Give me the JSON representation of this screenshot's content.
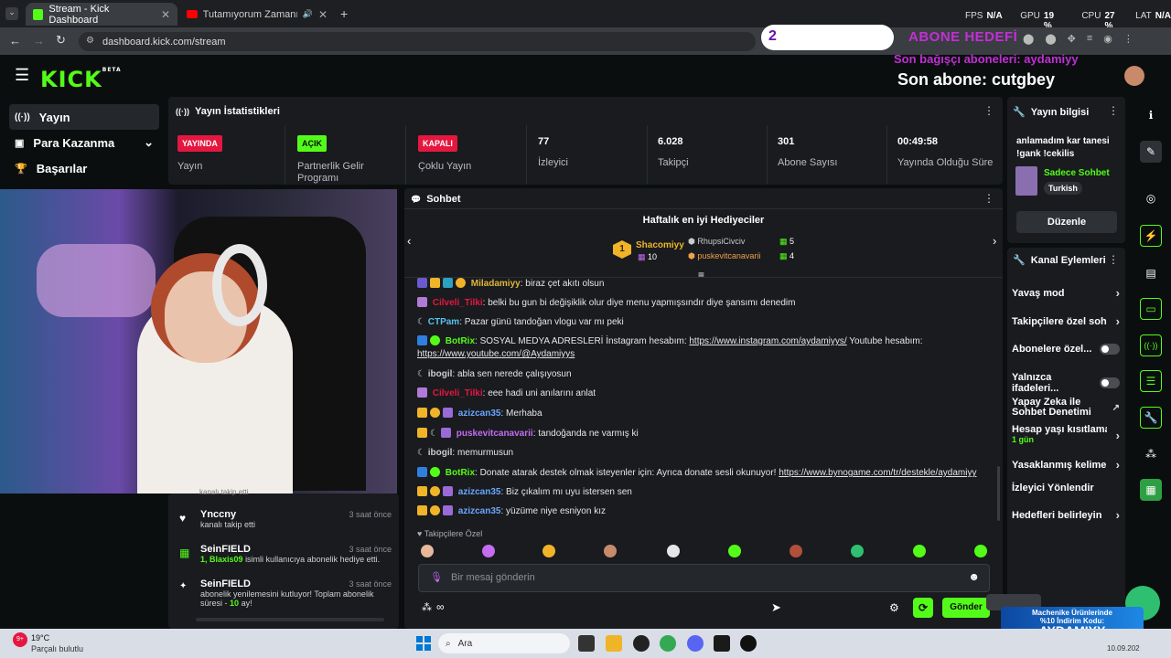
{
  "browser": {
    "tabs": [
      {
        "label": "Stream - Kick Dashboard",
        "active": true
      },
      {
        "label": "Tutamıyorum Zamanı (Mahmu",
        "active": false
      }
    ],
    "url": "dashboard.kick.com/stream"
  },
  "overlay": {
    "perf": {
      "fps_label": "FPS",
      "fps_value": "N/A",
      "gpu_label": "GPU",
      "gpu_value": "19 %",
      "cpu_label": "CPU",
      "cpu_value": "27 %",
      "lat_label": "LAT",
      "lat_value": "N/A"
    },
    "goal_count": "2",
    "goal_label": "ABONE HEDEFİ",
    "last_donor": "Son bağışçı aboneleri: aydamiyy",
    "last_sub": "Son abone: cutgbey"
  },
  "nav": {
    "items": [
      {
        "label": "Yayın",
        "icon": "broadcast-icon"
      },
      {
        "label": "Para Kazanma",
        "icon": "money-icon"
      },
      {
        "label": "Başarılar",
        "icon": "trophy-icon"
      }
    ]
  },
  "stats_panel": {
    "title": "Yayın İstatistikleri",
    "statuses": [
      {
        "badge": "YAYINDA",
        "label": "Yayın",
        "color": "#e5173f"
      },
      {
        "badge": "AÇIK",
        "label": "Partnerlik Gelir Programı",
        "color": "#53fc18"
      },
      {
        "badge": "KAPALI",
        "label": "Çoklu Yayın",
        "color": "#e5173f"
      }
    ],
    "metrics": [
      {
        "value": "77",
        "label": "İzleyici"
      },
      {
        "value": "6.028",
        "label": "Takipçi"
      },
      {
        "value": "301",
        "label": "Abone Sayısı"
      },
      {
        "value": "00:49:58",
        "label": "Yayında Olduğu Süre"
      }
    ]
  },
  "activity": [
    {
      "who": "Ynccny",
      "text": "kanalı takip etti",
      "time": "3 saat önce",
      "icon": "heart-icon"
    },
    {
      "who": "SeinFIELD",
      "text_prefix": "1, Blaxis09",
      "text": "isimli kullanıcıya abonelik hediye etti.",
      "time": "3 saat önce",
      "icon": "gift-icon"
    },
    {
      "who": "SeinFIELD",
      "text": "abonelik yenilemesini kutluyor! Toplam abonelik süresi -",
      "months": "10",
      "suffix": "ay!",
      "time": "3 saat önce",
      "icon": "star-icon"
    }
  ],
  "chat": {
    "title": "Sohbet",
    "top_gifters": {
      "title": "Haftalık en iyi Hediyeciler",
      "first": {
        "name": "Shacomiyy",
        "count": "10",
        "rank": "1"
      },
      "others": [
        {
          "name": "RhupsiCivciv",
          "count": "5"
        },
        {
          "name": "puskevitcanavarii",
          "count": "4"
        }
      ]
    },
    "messages": [
      {
        "user": "Miladamiyy",
        "text": "biraz çet akıtı olsun",
        "color": "#e0b53a"
      },
      {
        "user": "Cilveli_Tilki",
        "text": "belki bu gun bi değişiklik olur diye menu yapmışsındır diye şansımı denedim",
        "color": "#e5173f"
      },
      {
        "user": "CTPam",
        "text": "Pazar günü tandoğan vlogu var mı peki",
        "color": "#5bc0eb"
      },
      {
        "user": "BotRix",
        "text": "SOSYAL MEDYA ADRESLERİ İnstagram hesabım:",
        "link1": "https://www.instagram.com/aydamiyys/",
        "text2": "Youtube hesabım:",
        "link2": "https://www.youtube.com/@Aydamiyys",
        "color": "#53fc18"
      },
      {
        "user": "ibogil",
        "text": "abla sen nerede çalışıyosun",
        "color": "#c9cbcf"
      },
      {
        "user": "Cilveli_Tilki",
        "text": "eee hadi uni anılarını anlat",
        "color": "#e5173f"
      },
      {
        "user": "azizcan35",
        "text": "Merhaba",
        "color": "#6aa7ff"
      },
      {
        "user": "puskevitcanavarii",
        "text": "tandoğanda ne varmış ki",
        "color": "#c56cf0"
      },
      {
        "user": "ibogil",
        "text": "memurmusun",
        "color": "#c9cbcf"
      },
      {
        "user": "BotRix",
        "text": "Donate atarak destek olmak isteyenler için: Ayrıca donate sesli okunuyor!",
        "link1": "https://www.bynogame.com/tr/destekle/aydamiyy",
        "color": "#53fc18"
      },
      {
        "user": "azizcan35",
        "text": "Biz çıkalım mı uyu istersen sen",
        "color": "#6aa7ff"
      },
      {
        "user": "azizcan35",
        "text": "yüzüme niye esniyon kız",
        "color": "#6aa7ff"
      }
    ],
    "emotes_title": "Takipçilere Özel",
    "input_placeholder": "Bir mesaj gönderin",
    "send_label": "Gönder"
  },
  "stream_info": {
    "title": "Yayın bilgisi",
    "stream_title": "anlamadım kar tanesi !gank !cekilis",
    "category": "Sadece Sohbet",
    "language": "Turkish",
    "edit_label": "Düzenle"
  },
  "channel_actions": {
    "title": "Kanal Eylemleri",
    "items": [
      {
        "label": "Yavaş mod",
        "kind": "chevron"
      },
      {
        "label": "Takipçilere özel sohb",
        "kind": "chevron"
      },
      {
        "label": "Abonelere özel...",
        "kind": "toggle"
      },
      {
        "label": "Yalnızca ifadeleri...",
        "kind": "toggle"
      },
      {
        "label": "Yapay Zeka ile Sohbet Denetimi",
        "kind": "external"
      },
      {
        "label": "Hesap yaşı kısıtlaması",
        "sub": "1 gün",
        "kind": "chevron"
      },
      {
        "label": "Yasaklanmış kelimele",
        "kind": "chevron"
      },
      {
        "label": "İzleyici Yönlendir",
        "kind": "none"
      },
      {
        "label": "Hedefleri belirleyin",
        "kind": "chevron"
      }
    ]
  },
  "promo": {
    "line1": "Machenike Ürünlerinde",
    "line2": "%10 İndirim Kodu:",
    "code": "AYDAMIYY"
  },
  "taskbar": {
    "weather_temp": "19°C",
    "weather_desc": "Parçalı bulutlu",
    "weather_badge": "9+",
    "search_label": "Ara",
    "date": "10.09.202"
  }
}
